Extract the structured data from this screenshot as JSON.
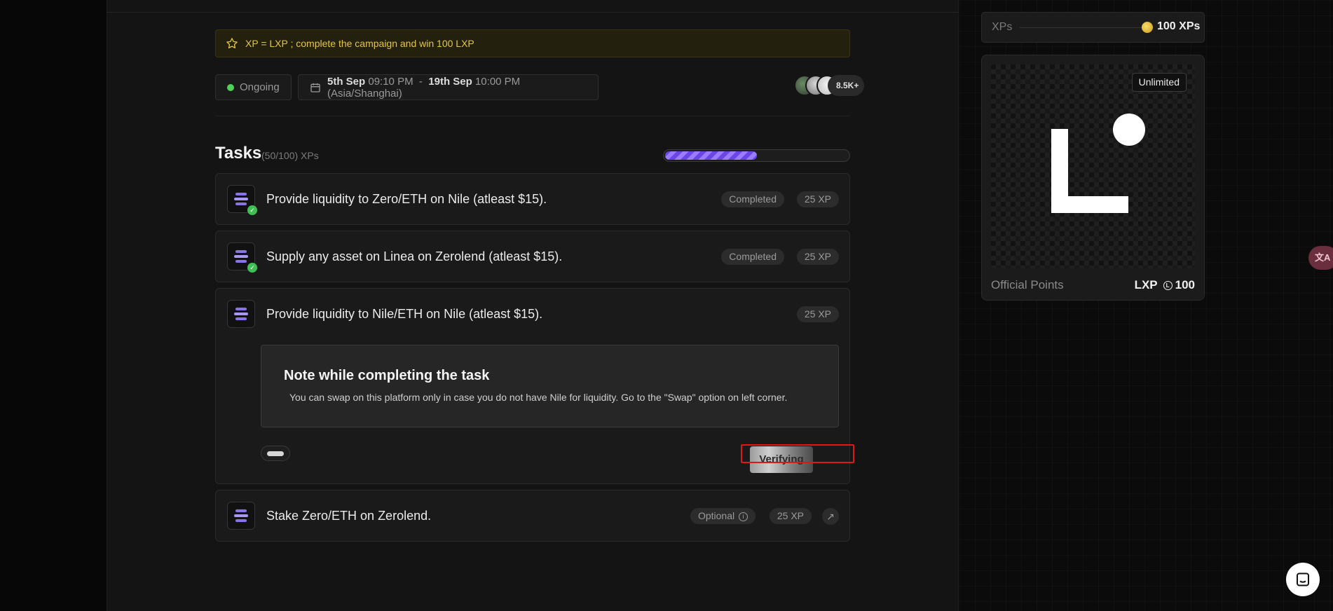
{
  "banner": {
    "text": "XP = LXP ; complete the campaign and win 100 LXP"
  },
  "campaign": {
    "status": "Ongoing",
    "start_bold": "5th Sep",
    "start_time": "09:10 PM",
    "separator": "-",
    "end_bold": "19th Sep",
    "end_time": "10:00 PM (Asia/Shanghai)",
    "participants": "8.5K+"
  },
  "tasks": {
    "title": "Tasks",
    "subtitle": "(50/100) XPs",
    "progress_fraction": 0.5,
    "items": [
      {
        "title": "Provide liquidity to Zero/ETH on Nile (atleast $15).",
        "status": "Completed",
        "xp": "25 XP"
      },
      {
        "title": "Supply any asset on Linea on Zerolend (atleast $15).",
        "status": "Completed",
        "xp": "25 XP"
      },
      {
        "title": "Provide liquidity to Nile/ETH on Nile (atleast $15).",
        "xp": "25 XP",
        "note_title": "Note while completing the task",
        "note_text": "You can swap on this platform only in case you do not have Nile for liquidity. Go to the \"Swap\" option on left corner.",
        "verify_label": "Verifying"
      },
      {
        "title": "Stake Zero/ETH on Zerolend.",
        "tag": "Optional",
        "xp": "25 XP"
      }
    ]
  },
  "reward": {
    "xp_label": "XPs",
    "xp_value": "100 XPs",
    "unlimited": "Unlimited",
    "footer_label": "Official Points",
    "token": "LXP",
    "amount": "100"
  },
  "widgets": {
    "translate_glyph": "文A"
  },
  "colors": {
    "accent_purple": "#7b5cf0",
    "banner_gold": "#e3c640",
    "status_green": "#52d158"
  }
}
